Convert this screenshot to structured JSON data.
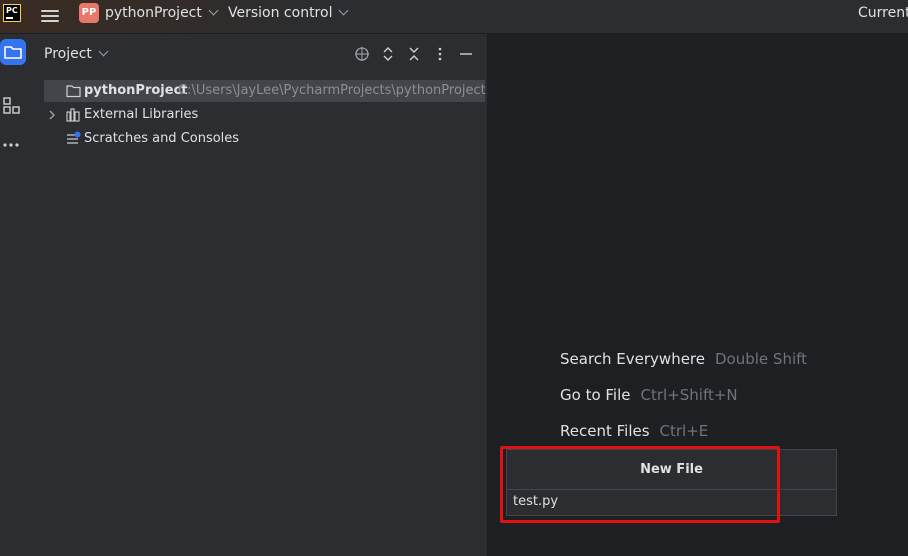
{
  "titlebar": {
    "logo_text": "PC",
    "project_badge": "PP",
    "project_name": "pythonProject",
    "vcs_label": "Version control",
    "run_config": "Current"
  },
  "toolstrip": {
    "items": [
      "project-tool",
      "structure-tool",
      "more-tools"
    ]
  },
  "project_panel": {
    "title": "Project",
    "tree": [
      {
        "label": "pythonProject",
        "path": "C:\\Users\\JayLee\\PycharmProjects\\pythonProject",
        "icon": "folder-icon",
        "selected": true
      },
      {
        "label": "External Libraries",
        "icon": "library-icon",
        "expandable": true
      },
      {
        "label": "Scratches and Consoles",
        "icon": "scratches-icon"
      }
    ]
  },
  "editor": {
    "hints": [
      {
        "label": "Search Everywhere",
        "shortcut": "Double Shift"
      },
      {
        "label": "Go to File",
        "shortcut": "Ctrl+Shift+N"
      },
      {
        "label": "Recent Files",
        "shortcut": "Ctrl+E"
      }
    ],
    "new_file_popup": {
      "title": "New File",
      "value": "test.py"
    }
  },
  "colors": {
    "accent": "#3574f0",
    "badge": "#e8786b",
    "highlight": "#e21010",
    "panel_bg": "#2b2d30",
    "editor_bg": "#1e1f22"
  }
}
